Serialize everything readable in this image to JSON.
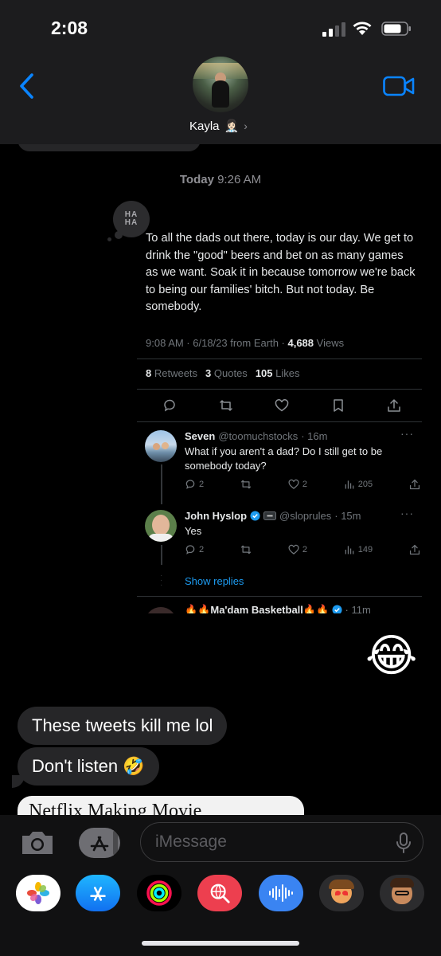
{
  "status": {
    "time": "2:08"
  },
  "header": {
    "contact_name": "Kayla",
    "contact_emoji": "👩🏻‍⚕️",
    "chevron": "›",
    "back_icon": "chevron-left-icon",
    "video_icon": "video-camera-icon",
    "accent": "#0a84ff"
  },
  "thread": {
    "timestamp_day": "Today",
    "timestamp_time": "9:26 AM",
    "tapback": [
      "HA",
      "HA"
    ]
  },
  "tweet": {
    "text": "To all the dads out there, today is our day. We get to drink the \"good\" beers and bet on as many games as we want. Soak it in because tomorrow we're back to being our families' bitch. But not today. Be somebody.",
    "meta_prefix": "9:08 AM · 6/18/23 from Earth · ",
    "views_count": "4,688",
    "views_label": " Views",
    "retweets_count": "8",
    "retweets_label": " Retweets",
    "quotes_count": "3",
    "quotes_label": " Quotes",
    "likes_count": "105",
    "likes_label": " Likes",
    "replies": [
      {
        "name": "Seven",
        "handle": "@toomuchstocks",
        "time": "· 16m",
        "text": "What if you aren't a dad? Do I still get to be somebody today?",
        "reply_count": "2",
        "like_count": "2",
        "view_count": "205"
      },
      {
        "name": "John Hyslop",
        "handle": "@sloprules",
        "time": "· 15m",
        "text": "Yes",
        "reply_count": "2",
        "like_count": "2",
        "view_count": "149"
      }
    ],
    "show_replies": "Show replies",
    "cut_reply_name": "🔥🔥Ma'dam Basketball🔥🔥",
    "cut_reply_time": "· 11m",
    "more": "···"
  },
  "reaction_emoji": "😂",
  "messages": [
    {
      "text": "These tweets kill me lol"
    },
    {
      "text": "Don't listen 🤣"
    }
  ],
  "link_preview_title": "Netflix Making Movie",
  "composer": {
    "placeholder": "iMessage",
    "camera_icon": "camera-icon",
    "apps_icon": "app-store-icon",
    "mic_icon": "microphone-icon"
  },
  "app_drawer": [
    "photos-icon",
    "app-store-icon",
    "activity-icon",
    "web-search-icon",
    "audio-message-icon",
    "memoji-stickers-icon",
    "memoji-icon"
  ]
}
